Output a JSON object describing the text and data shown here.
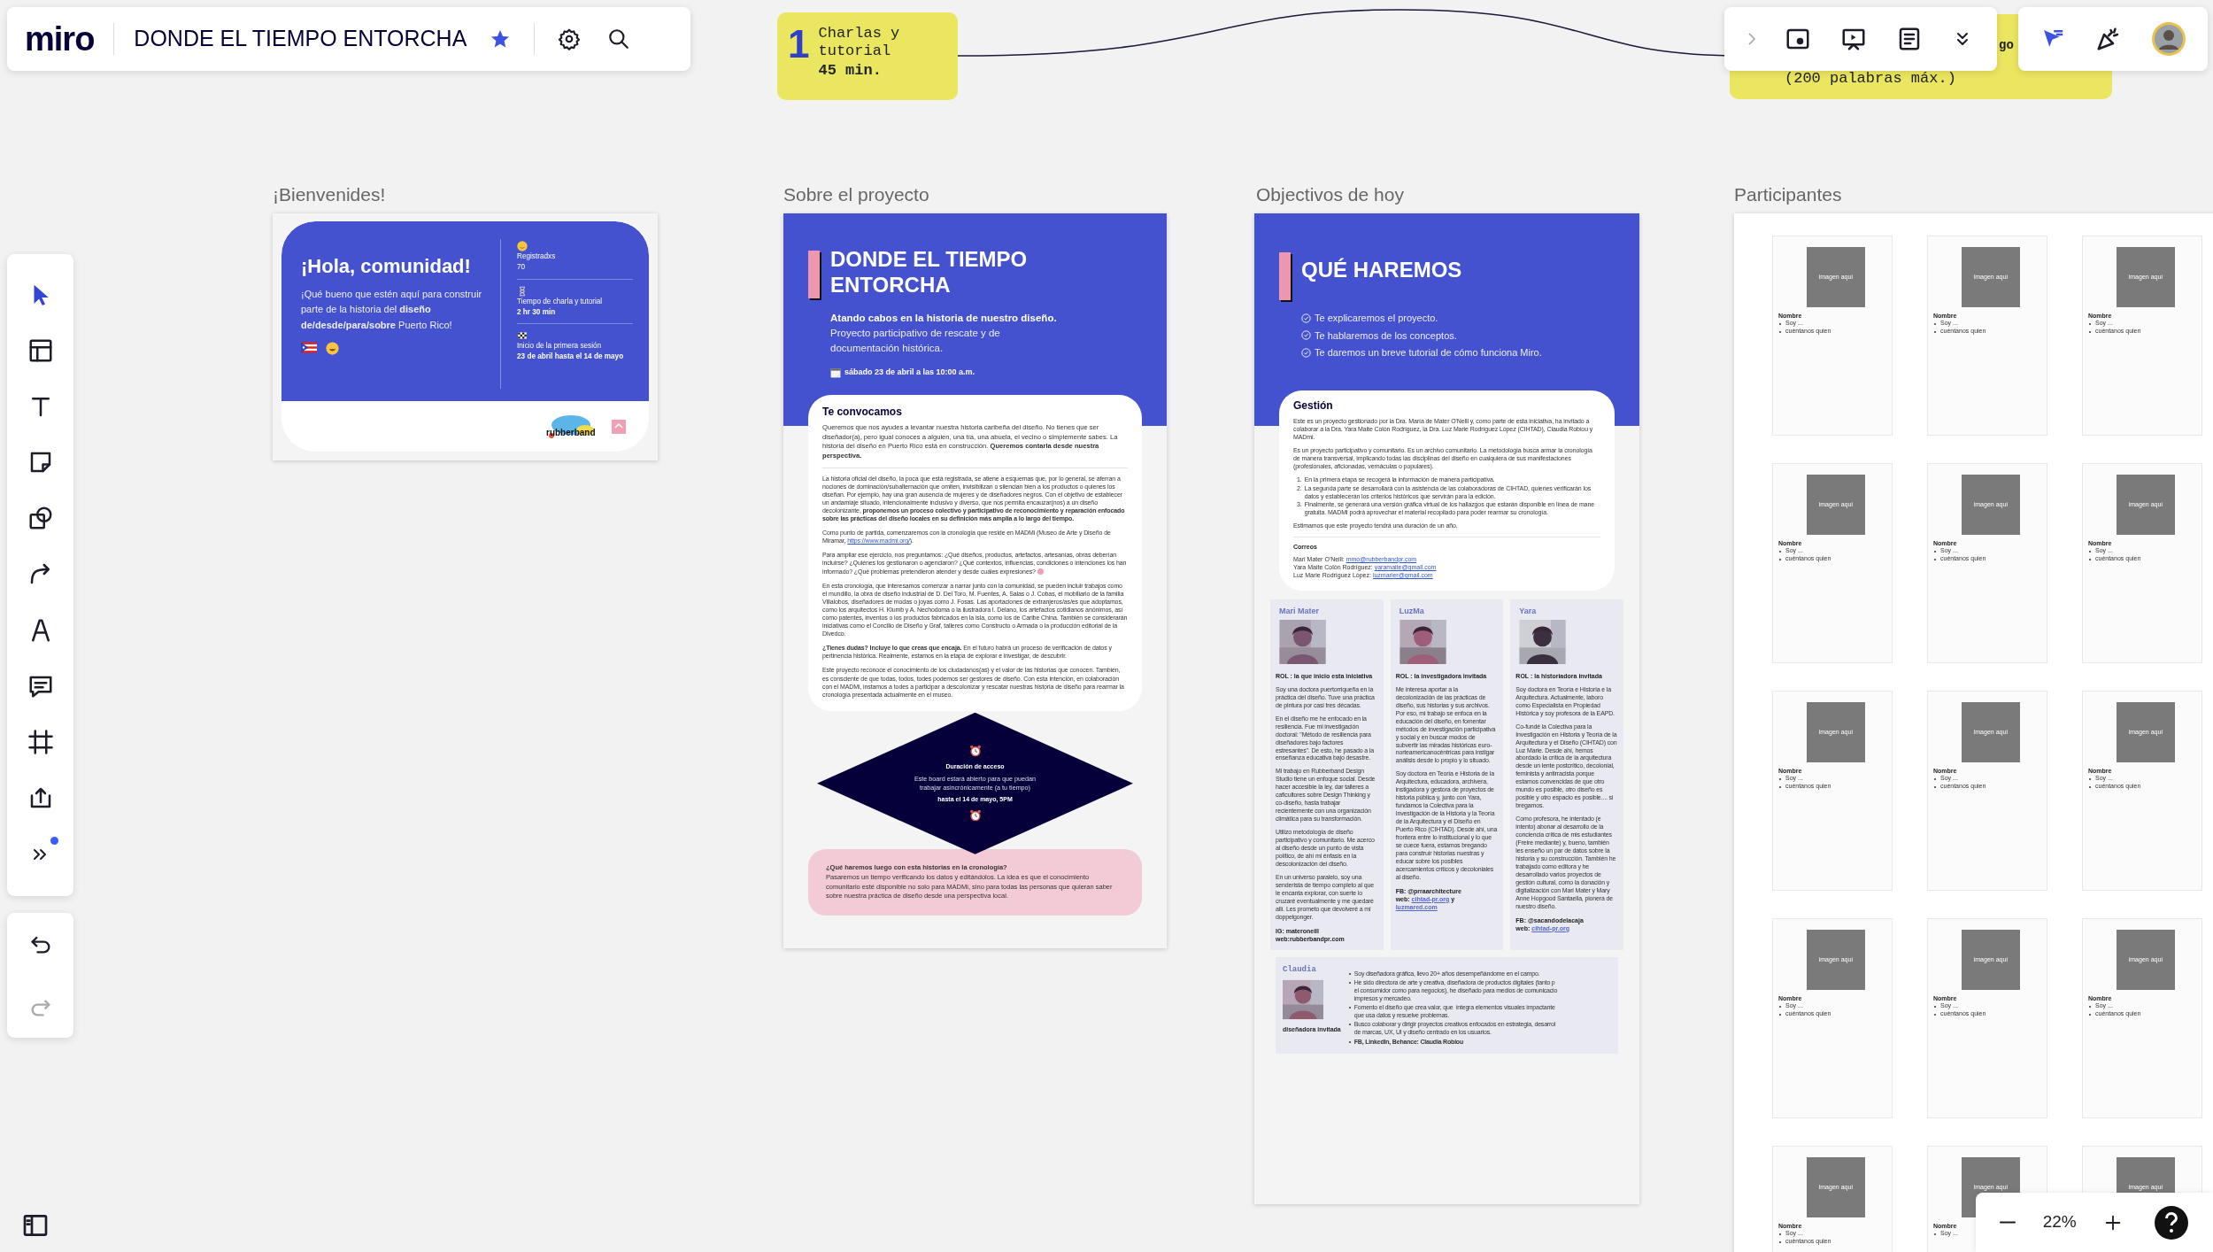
{
  "board": {
    "logo": "miro",
    "title": "DONDE EL TIEMPO ENTORCHA",
    "starred": true
  },
  "stickies": [
    {
      "number": "1",
      "text": "Charlas y tutorial",
      "duration": "45 min."
    },
    {
      "fragment": "go",
      "text": "(200 palabras máx.)"
    }
  ],
  "welcome": {
    "label": "¡Bienvenides!",
    "heading": "¡Hola, comunidad!",
    "message": "¡Qué bueno que estén aquí para construir parte de la historia del **diseño de/desde/para/sobre** Puerto Rico!",
    "stats": [
      {
        "label": "Registradxs",
        "value": "70",
        "bold": false
      },
      {
        "label": "Tiempo  de charla y tutorial",
        "value": "2 hr 30 min",
        "bold": true
      },
      {
        "label": "Inicio de la primera sesión",
        "value": "23 de abril hasta el 14 de mayo",
        "bold": true
      }
    ],
    "logo": "rubberband"
  },
  "about": {
    "label": "Sobre el proyecto",
    "title": "DONDE EL TIEMPO ENTORCHA",
    "tagline": "Atando cabos en la historia de nuestro diseño.",
    "subtitle": "Proyecto participativo de rescate y de documentación histórica.",
    "date": "sábado 23 de abril a las 10:00 a.m.",
    "card_title": "Te convocamos",
    "intro": "Queremos que nos ayudes a levantar nuestra historia caribeña del diseño. No tienes que ser diseñador(a), pero igual conoces a alguien, una tía, una abuela, el vecino o simplemente sabes. La historia del diseño en Puerto Rico está en construcción. **Queremos contarla desde nuestra perspectiva.**",
    "paragraphs": [
      {
        "text": "La historia oficial del diseño, la poca que está registrada, se atiene a esquemas que, por lo general, se aferran a nociones de dominación/subalternación que omiten, invisibilizan o silencian bien a los productos o quienes los diseñan. Por ejemplo, hay una gran ausencia de mujeres y de diseñadores negros. Con el objetivo de establecer un andamiaje situado, intencionalmente inclusivo y diverso, que nos permita encauzar(nos) a un diseño decolonizante, **proponemos un proceso colectivo y participativo de reconocimiento y reparación enfocado sobre las prácticas del diseño locales en su definición más amplia a lo largo del tiempo.**"
      },
      {
        "text": "Como punto de partida, comenzaremos con la cronología que reside en MADMi (Museo de Arte y Diseño de Miramar,",
        "link": "https://www.madmi.org/",
        "after": ")."
      },
      {
        "text": "Para ampliar ese ejercicio, nos preguntamos:  ¿Qué diseños, productos, artefactos, artesanías, obras deberían incluirse? ¿Quiénes los gestionaron o agenciaron? ¿Qué contextos, influencias, condiciones o intenciones los han informado? ¿Qué problemas pretendieron atender y desde cuáles expresiones?"
      },
      {
        "text": "En esta cronología, que interesamos comenzar a narrar junto con la comunidad, se pueden incluir trabajos como el mundillo, la obra de diseño industrial de D. Del Toro, M. Fuentes, A. Salas o J. Cobas, el mobiliario de la familia Villalobos, diseñadores de modas o joyas como J. Fosas. Las aportaciones de extranjeros/as/es que adoptamos, como los arquitectos H. Klumb y A. Nechodoma o la ilustradora I. Delano, los artefactos cotidianos anónimos, así como patentes, inventos o los productos fabricados en la isla, como los de Caribe China. También se considerarán iniciativas como el Concilio de Diseño y Graf, talleres como Constructo o Armada o la producción editorial de la Divedco."
      },
      {
        "text": "**¿Tienes dudas? Incluye lo que creas que encaja.** En el futuro habrá un proceso de verificación de datos y pertinencia histórica. Realmente, estamos en la etapa de explorar e investigar, de descubrir."
      },
      {
        "text": "Este proyecto reconoce el conocimiento de los ciudadanos(as) y el valor de las historias que conocen. También, es consciente de que todas, todos, todes podemos ser gestores de diseño. Con esta intención, en colaboración con el MADMi, instamos a todes a participar a descolonizar y rescatar nuestras historia de diseño para rearmar la cronología presentada actualmente en el museo."
      }
    ],
    "access": {
      "title": "Duración de acceso",
      "text": "Este board estará abierto para que puedan trabajar asincrónicamente (a tu tiempo)",
      "deadline": "hasta el 14 de mayo, 5PM"
    },
    "next": {
      "question": "¿Qué haremos luego con esta historias en la cronología?",
      "text": "Pasaremos un tiempo verificando los datos y editándolos. La idea es que el conocimiento comunitario esté disponible no solo para MADMi, sino para todas las personas que quieran saber sobre nuestra práctica de diseño desde una perspectiva local."
    }
  },
  "goals": {
    "label": "Objectivos de hoy",
    "title": "QUÉ HAREMOS",
    "checklist": [
      "Te explicaremos el proyecto.",
      "Te hablaremos de los conceptos.",
      "Te daremos un breve tutorial de cómo funciona Miro."
    ],
    "card_title": "Gestión",
    "paragraphs": [
      "Este es un proyecto gestionado por la Dra. María de Mater O'Neill y, como parte de esta iniciativa, ha invitado a colaborar a la Dra. Yara Maite Colón Rodríguez, la Dra. Luz Marie Rodríguez López (CIHTAD), Claudia Robiou y MADmi.",
      "Es un proyecto participativo y comunitario. Es un archivo comunitario. La metodología busca armar la cronología de manera transversal, implicando todas las disciplinas del diseño en cualquiera de sus manifestaciones (profesionales, aficionadas, vernáculas o populares)."
    ],
    "steps": [
      {
        "number": "1.",
        "text": "En la primera etapa se recogerá la información de manera participativa."
      },
      {
        "number": "2.",
        "text": "La segunda parte se desarrollará con la asistencia de las colaboradoras de CIHTAD, quienes verificarán los\ndatos y establecerán los criterios históricos que servirán para la edición."
      },
      {
        "number": "3.",
        "text": "Finalmente, se generará una versión gráfica virtual de los hallazgos que estarán disponible en línea de mane\ngratuita. MADMI podrá aprovechar el material recopilado para poder rearmar su cronología."
      }
    ],
    "closing": "Estimamos que este proyecto tendrá una duración de un año.",
    "emails_title": "Correos",
    "emails": [
      {
        "name": "Mari Mater O'Neill:",
        "email": "mmo@rubberbandpr.com"
      },
      {
        "name": "Yara Maite Colón Rodríguez:",
        "email": "yaramaite@gmail.com"
      },
      {
        "name": "Luz Marie Rodríguez López:",
        "email": "luzmarier@gmail.com"
      }
    ],
    "profiles": [
      {
        "name": "Mari Mater",
        "role": "ROL : la que inicio esta iniciativa",
        "paragraphs": [
          "Soy una doctora puertorriqueña en la práctica del diseño. Tuve una práctica de pintura por casi tres décadas.",
          "En el diseño me he enfocado en la resiliencia. Fue mi investigación doctoral: \"Método de resiliencia para diseñadores bajo factores estresantes\". De esto, he pasado a la  enseñanza educativa bajo desastre.",
          "Mi trabajo en Rubberband Design Studio tiene un enfoque social. Desde hacer accesible la ley, dar talleres a caficultores sobre Design Thinking y co-diseño, hasta trabajar recientemente con una organización climática para su transformación.",
          "Utilizo metodología de diseño participativo y  comunitario. Me acerco al diseño desde un punto de vista político, de ahí mi énfasis en la descolonización del diseño.",
          "En un universo  paralelo, soy una senderista de tiempo completo al que le encanta explorar, con suerte lo cruzaré eventualmente y me quedaré allí. Les  prometo que devolveré a mi doppelgonger."
        ],
        "footer": [
          [
            {
              "kind": "text",
              "text": "IG: materoneill"
            }
          ],
          [
            {
              "kind": "text",
              "text": "web:rubberbandpr.com"
            }
          ]
        ]
      },
      {
        "name": "LuzMa",
        "role": "ROL : la investigadora invitada",
        "paragraphs": [
          "Me interesa aportar a la decolonización de las prácticas de diseño, sus historias y sus archivos. Por eso, mi trabajo se enfoca en la educación del diseño, en fomentar métodos de investigación participativa y social y en buscar modos de subvertir las miradas históricas euro-norteamericanocéntricas para instigar análisis desde lo propio y lo situado.",
          "Soy doctora en Teoría e Historia de la Arquitectura, educadora, archivera, instigadora y gestora de proyectos de historia pública y, junto con Yara, fundamos la Colectiva para la Investigación de la Historia y la Teoría de la Arquitectura y el Diseño en Puerto Rico (CIHTAD). Desde ahí, una frontera entre lo institucional y lo que se cuece fuera, estamos bregando para construir historias nuestras y educar sobre los posibles acercamientos críticos y decoloniales al diseño."
        ],
        "footer": [
          [
            {
              "kind": "text",
              "text": "FB: @prraarchitecture"
            }
          ],
          [
            {
              "kind": "text",
              "text": "web:"
            },
            {
              "kind": "link",
              "text": "cihtad-pr.org"
            },
            {
              "kind": "text",
              "text": "y"
            }
          ],
          [
            {
              "kind": "link",
              "text": "luzmared.com"
            }
          ]
        ]
      },
      {
        "name": "Yara",
        "role": "ROL : la historiadora invitada",
        "paragraphs": [
          "Soy doctora en Teoría e Historia e la Arquitectura. Actualmente, laboro como Especialista en Propiedad Histórica y soy profesora de la EAPD.",
          "Co-fundé la Colectiva para la Investigación en Historia y Teoría de la Arquitectura y el Diseño (CIHTAD) con Luz Marie. Desde ahí, hemos abordado la crítica de la arquitectura desde un lente postcrítico, decolonial, feminista y antirracista porque estamos convencidas de que otro mundo es posible, otro diseño es posible y otro espacio es posible.... si bregamos.",
          "Como profesora, he intentado (e intento) abonar al desarrollo de la conciencia crítica de mis estudiantes (Freire mediante) y, bueno, también les enseño un par de datos sobre la historia y su construcción. También he trabajado como editora y he desarrollado varios proyectos de gestión cultural, como la donación y digitalización con Mari Mater y Mary Anne Hopgood Santaella, pionera de nuestro diseño."
        ],
        "footer": [
          [
            {
              "kind": "text",
              "text": "FB: @sacandodelacaja"
            }
          ],
          [
            {
              "kind": "text",
              "text": "web:"
            },
            {
              "kind": "link",
              "text": "cihtad-pr.org"
            }
          ]
        ]
      }
    ],
    "guest": {
      "name": "Claudia",
      "caption": "diseñadora invitada",
      "bullets": [
        "Soy diseñadora gráfica, llevo 20+ años desempeñándome en el campo.",
        "He sido directora de arte y creativa, diseñadora de productos digitales (tanto p\nel consumidor como para negocios), he diseñado para medios de comunicacio\nimpresos y mercadeo.",
        "Fomento el diseño que crea valor, que  integra elementos visuales impactante\nque usa datos y resuelve problemas.",
        "Busco colaborar y dirigir proyectos creativos enfocados en estrategia, desarrol\nde marcas, UX, UI y diseño centrado en los usuarios.",
        "**FB, LinkedIn, Behance: Claudia Robiou**"
      ]
    }
  },
  "participants": {
    "label": "Participantes",
    "cards": [
      {
        "image": "imagen aquí",
        "name": "Nombre",
        "lines": [
          "Soy ...",
          "cuéntanos quien"
        ]
      },
      {
        "image": "imagen aquí",
        "name": "Nombre",
        "lines": [
          "Soy ...",
          "cuéntanos quien"
        ]
      },
      {
        "image": "imagen aquí",
        "name": "Nombre",
        "lines": [
          "Soy ...",
          "cuéntanos quien"
        ]
      },
      {
        "image": "imagen aquí",
        "name": "Nombre",
        "lines": [
          "Soy ...",
          "cuéntanos quien"
        ]
      },
      {
        "image": "imagen aquí",
        "name": "Nombre",
        "lines": [
          "Soy ...",
          "cuéntanos quien"
        ]
      },
      {
        "image": "imagen aquí",
        "name": "Nombre",
        "lines": [
          "Soy ...",
          "cuéntanos quien"
        ]
      },
      {
        "image": "imagen aquí",
        "name": "Nombre",
        "lines": [
          "Soy ...",
          "cuéntanos quien"
        ]
      },
      {
        "image": "imagen aquí",
        "name": "Nombre",
        "lines": [
          "Soy ...",
          "cuéntanos quien"
        ]
      },
      {
        "image": "imagen aquí",
        "name": "Nombre",
        "lines": [
          "Soy ...",
          "cuéntanos quien"
        ]
      },
      {
        "image": "imagen aquí",
        "name": "Nombre",
        "lines": [
          "Soy ...",
          "cuéntanos quien"
        ]
      },
      {
        "image": "imagen aquí",
        "name": "Nombre",
        "lines": [
          "Soy ...",
          "cuéntanos quien"
        ]
      },
      {
        "image": "imagen aquí",
        "name": "Nombre",
        "lines": [
          "Soy ...",
          "cuéntanos quien"
        ]
      },
      {
        "image": "imagen aquí",
        "name": "Nombre",
        "lines": [
          "Soy ...",
          "cuéntanos quien"
        ]
      },
      {
        "image": "imagen aquí",
        "name": "Nombre",
        "lines": [
          "Soy ..."
        ]
      },
      {
        "image": "imagen aquí"
      }
    ]
  },
  "zoom": {
    "level": "22%"
  }
}
